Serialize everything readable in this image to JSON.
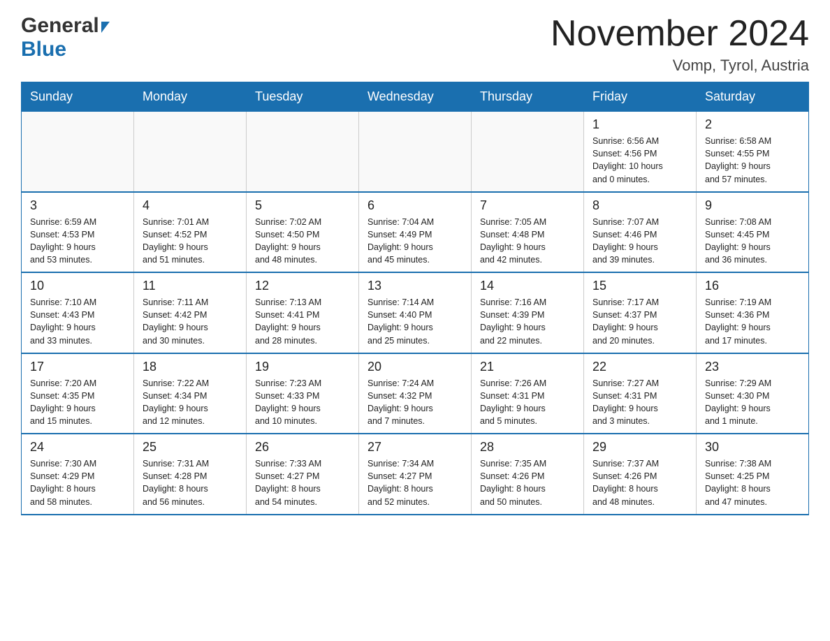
{
  "header": {
    "logo_general": "General",
    "logo_blue": "Blue",
    "title": "November 2024",
    "subtitle": "Vomp, Tyrol, Austria"
  },
  "weekdays": [
    "Sunday",
    "Monday",
    "Tuesday",
    "Wednesday",
    "Thursday",
    "Friday",
    "Saturday"
  ],
  "weeks": [
    [
      {
        "day": "",
        "info": ""
      },
      {
        "day": "",
        "info": ""
      },
      {
        "day": "",
        "info": ""
      },
      {
        "day": "",
        "info": ""
      },
      {
        "day": "",
        "info": ""
      },
      {
        "day": "1",
        "info": "Sunrise: 6:56 AM\nSunset: 4:56 PM\nDaylight: 10 hours\nand 0 minutes."
      },
      {
        "day": "2",
        "info": "Sunrise: 6:58 AM\nSunset: 4:55 PM\nDaylight: 9 hours\nand 57 minutes."
      }
    ],
    [
      {
        "day": "3",
        "info": "Sunrise: 6:59 AM\nSunset: 4:53 PM\nDaylight: 9 hours\nand 53 minutes."
      },
      {
        "day": "4",
        "info": "Sunrise: 7:01 AM\nSunset: 4:52 PM\nDaylight: 9 hours\nand 51 minutes."
      },
      {
        "day": "5",
        "info": "Sunrise: 7:02 AM\nSunset: 4:50 PM\nDaylight: 9 hours\nand 48 minutes."
      },
      {
        "day": "6",
        "info": "Sunrise: 7:04 AM\nSunset: 4:49 PM\nDaylight: 9 hours\nand 45 minutes."
      },
      {
        "day": "7",
        "info": "Sunrise: 7:05 AM\nSunset: 4:48 PM\nDaylight: 9 hours\nand 42 minutes."
      },
      {
        "day": "8",
        "info": "Sunrise: 7:07 AM\nSunset: 4:46 PM\nDaylight: 9 hours\nand 39 minutes."
      },
      {
        "day": "9",
        "info": "Sunrise: 7:08 AM\nSunset: 4:45 PM\nDaylight: 9 hours\nand 36 minutes."
      }
    ],
    [
      {
        "day": "10",
        "info": "Sunrise: 7:10 AM\nSunset: 4:43 PM\nDaylight: 9 hours\nand 33 minutes."
      },
      {
        "day": "11",
        "info": "Sunrise: 7:11 AM\nSunset: 4:42 PM\nDaylight: 9 hours\nand 30 minutes."
      },
      {
        "day": "12",
        "info": "Sunrise: 7:13 AM\nSunset: 4:41 PM\nDaylight: 9 hours\nand 28 minutes."
      },
      {
        "day": "13",
        "info": "Sunrise: 7:14 AM\nSunset: 4:40 PM\nDaylight: 9 hours\nand 25 minutes."
      },
      {
        "day": "14",
        "info": "Sunrise: 7:16 AM\nSunset: 4:39 PM\nDaylight: 9 hours\nand 22 minutes."
      },
      {
        "day": "15",
        "info": "Sunrise: 7:17 AM\nSunset: 4:37 PM\nDaylight: 9 hours\nand 20 minutes."
      },
      {
        "day": "16",
        "info": "Sunrise: 7:19 AM\nSunset: 4:36 PM\nDaylight: 9 hours\nand 17 minutes."
      }
    ],
    [
      {
        "day": "17",
        "info": "Sunrise: 7:20 AM\nSunset: 4:35 PM\nDaylight: 9 hours\nand 15 minutes."
      },
      {
        "day": "18",
        "info": "Sunrise: 7:22 AM\nSunset: 4:34 PM\nDaylight: 9 hours\nand 12 minutes."
      },
      {
        "day": "19",
        "info": "Sunrise: 7:23 AM\nSunset: 4:33 PM\nDaylight: 9 hours\nand 10 minutes."
      },
      {
        "day": "20",
        "info": "Sunrise: 7:24 AM\nSunset: 4:32 PM\nDaylight: 9 hours\nand 7 minutes."
      },
      {
        "day": "21",
        "info": "Sunrise: 7:26 AM\nSunset: 4:31 PM\nDaylight: 9 hours\nand 5 minutes."
      },
      {
        "day": "22",
        "info": "Sunrise: 7:27 AM\nSunset: 4:31 PM\nDaylight: 9 hours\nand 3 minutes."
      },
      {
        "day": "23",
        "info": "Sunrise: 7:29 AM\nSunset: 4:30 PM\nDaylight: 9 hours\nand 1 minute."
      }
    ],
    [
      {
        "day": "24",
        "info": "Sunrise: 7:30 AM\nSunset: 4:29 PM\nDaylight: 8 hours\nand 58 minutes."
      },
      {
        "day": "25",
        "info": "Sunrise: 7:31 AM\nSunset: 4:28 PM\nDaylight: 8 hours\nand 56 minutes."
      },
      {
        "day": "26",
        "info": "Sunrise: 7:33 AM\nSunset: 4:27 PM\nDaylight: 8 hours\nand 54 minutes."
      },
      {
        "day": "27",
        "info": "Sunrise: 7:34 AM\nSunset: 4:27 PM\nDaylight: 8 hours\nand 52 minutes."
      },
      {
        "day": "28",
        "info": "Sunrise: 7:35 AM\nSunset: 4:26 PM\nDaylight: 8 hours\nand 50 minutes."
      },
      {
        "day": "29",
        "info": "Sunrise: 7:37 AM\nSunset: 4:26 PM\nDaylight: 8 hours\nand 48 minutes."
      },
      {
        "day": "30",
        "info": "Sunrise: 7:38 AM\nSunset: 4:25 PM\nDaylight: 8 hours\nand 47 minutes."
      }
    ]
  ]
}
